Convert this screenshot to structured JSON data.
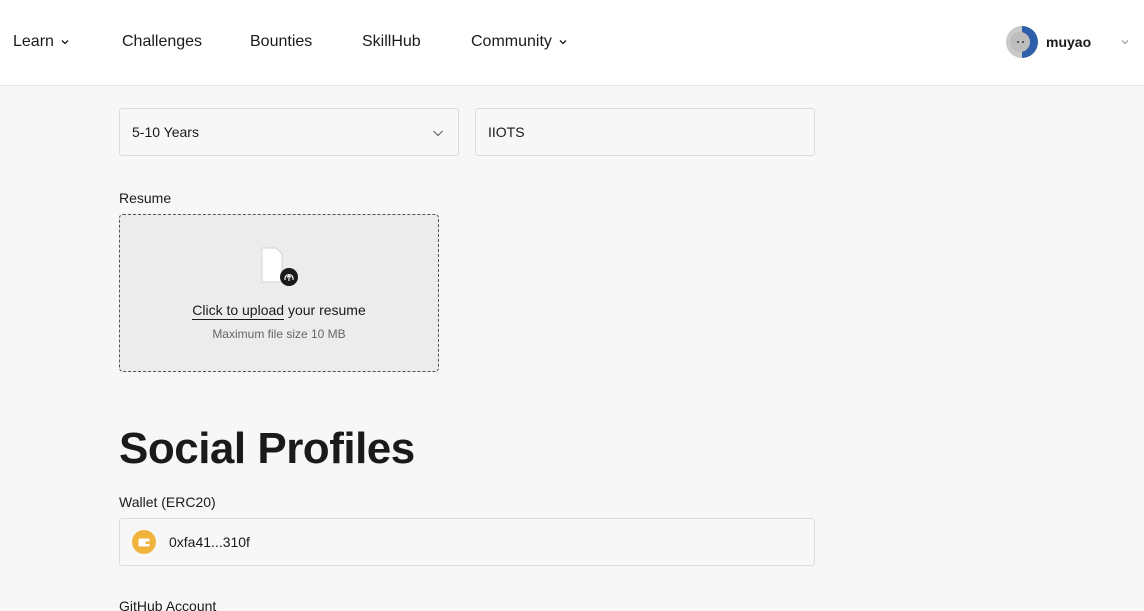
{
  "nav": {
    "items": [
      {
        "label": "Learn",
        "has_dropdown": true
      },
      {
        "label": "Challenges",
        "has_dropdown": false
      },
      {
        "label": "Bounties",
        "has_dropdown": false
      },
      {
        "label": "SkillHub",
        "has_dropdown": false
      },
      {
        "label": "Community",
        "has_dropdown": true
      }
    ],
    "user": {
      "name": "muyao",
      "avatar_icon": "avatar-icon"
    }
  },
  "form": {
    "experience": {
      "value": "5-10 Years",
      "icon": "chevron-down-icon"
    },
    "organization": {
      "value": "IIOTS"
    },
    "resume": {
      "label": "Resume",
      "upload_link": "Click to upload",
      "upload_suffix": " your resume",
      "max_size": "Maximum file size 10 MB",
      "icon": "file-upload-icon"
    },
    "social": {
      "title": "Social Profiles",
      "wallet": {
        "label": "Wallet (ERC20)",
        "value": "0xfa41...310f",
        "icon": "wallet-icon",
        "icon_color": "#f0b43c"
      },
      "github": {
        "label": "GitHub Account"
      }
    }
  },
  "colors": {
    "background": "#f7f7f7",
    "nav_bg": "#ffffff",
    "border": "#dcdcdc",
    "accent": "#f0b43c"
  }
}
